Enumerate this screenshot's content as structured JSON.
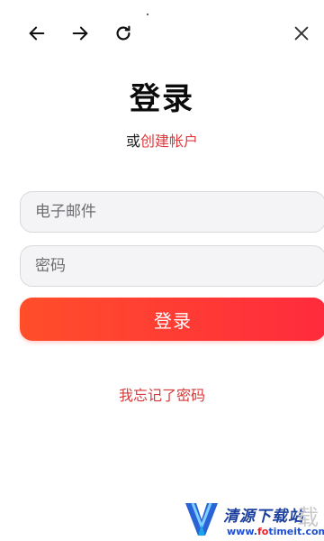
{
  "nav": {
    "back_icon": "arrow-left-icon",
    "forward_icon": "arrow-right-icon",
    "reload_icon": "reload-icon",
    "close_icon": "close-icon"
  },
  "page": {
    "title": "登录",
    "subline_prefix": "或",
    "create_account_link": "创建帐户"
  },
  "form": {
    "email_placeholder": "电子邮件",
    "password_placeholder": "密码",
    "submit_label": "登录",
    "forgot_link": "我忘记了密码"
  },
  "watermark": {
    "site_name": "清源下载站",
    "url_prefix": "www.",
    "url_highlight": "fo",
    "url_suffix": "timeit.com",
    "ghost_char": "载"
  },
  "colors": {
    "accent_red": "#e0383d",
    "button_gradient_start": "#ff4e2a",
    "button_gradient_end": "#ff2b3d",
    "field_bg": "#f4f4f7"
  }
}
